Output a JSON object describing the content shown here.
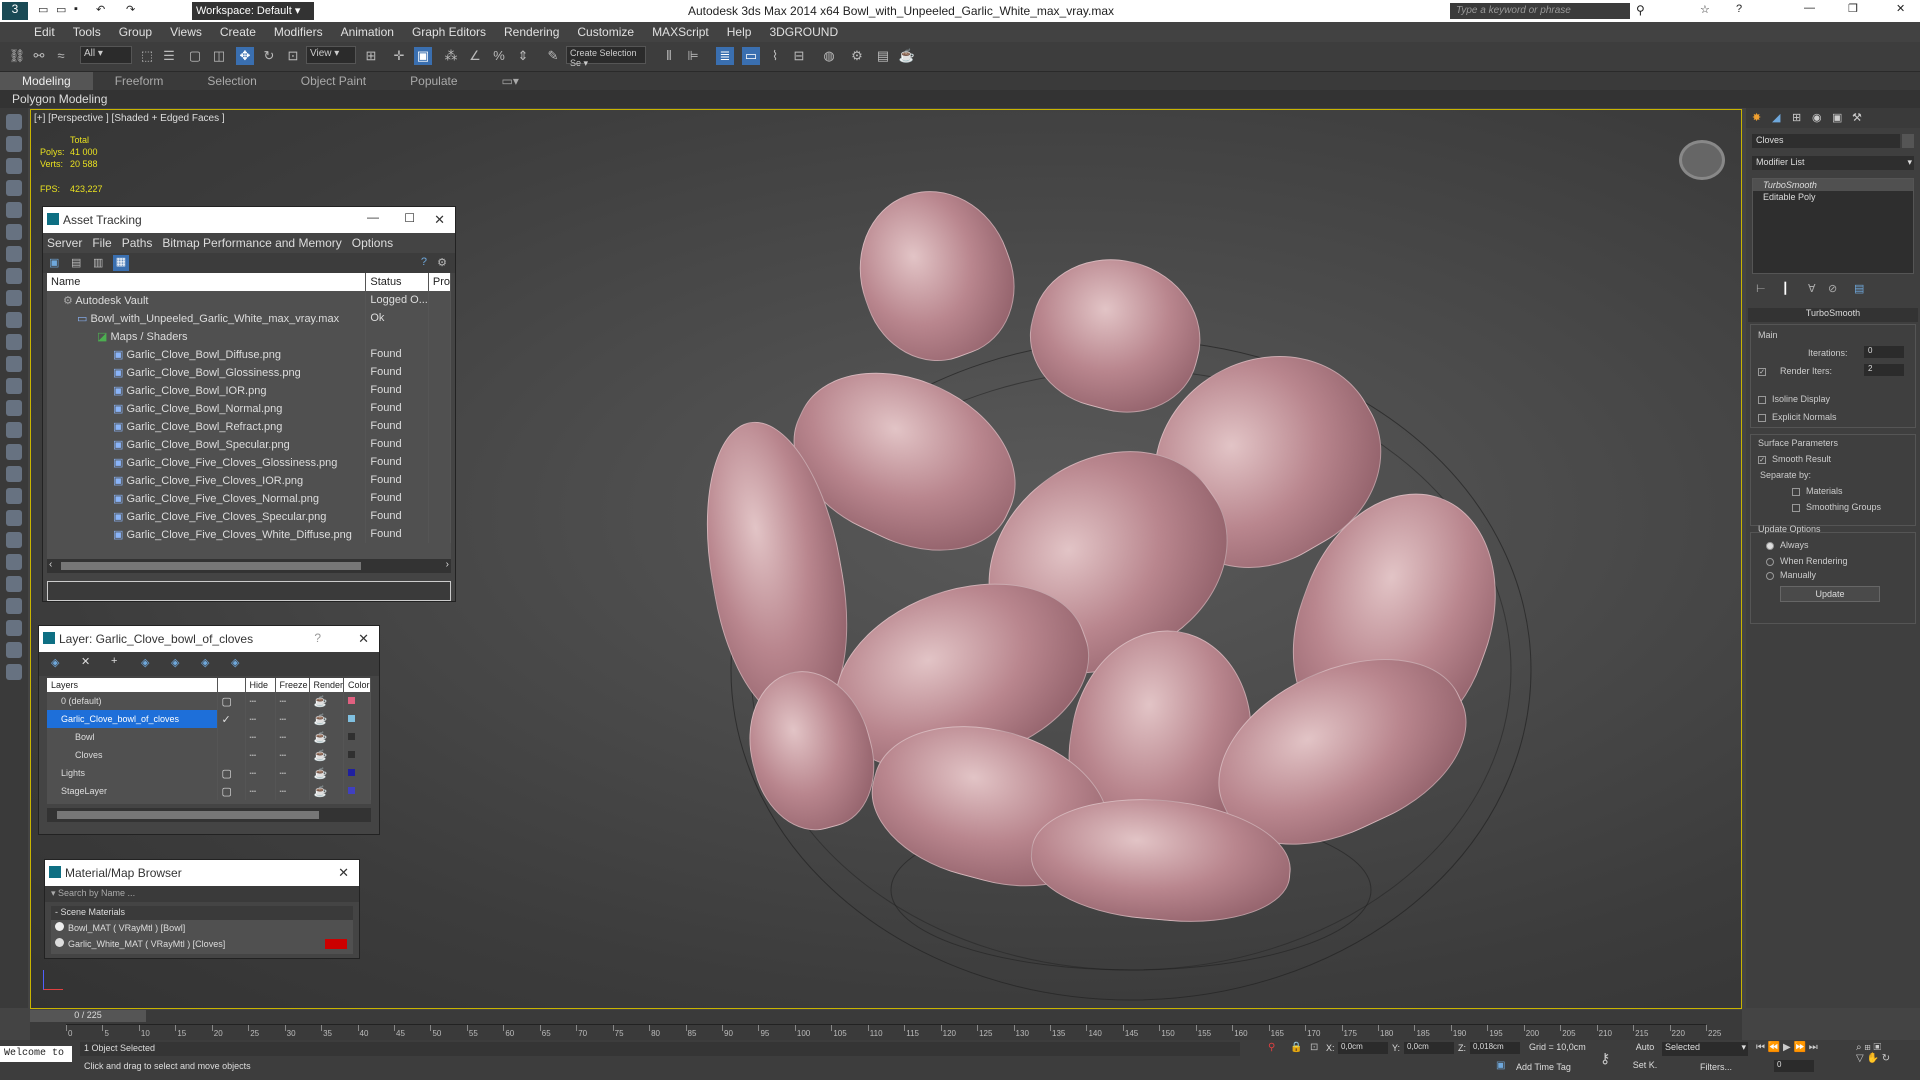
{
  "window": {
    "title": "Autodesk 3ds Max  2014 x64      Bowl_with_Unpeeled_Garlic_White_max_vray.max",
    "workspace": "Workspace: Default",
    "search_placeholder": "Type a keyword or phrase"
  },
  "menu": [
    "Edit",
    "Tools",
    "Group",
    "Views",
    "Create",
    "Modifiers",
    "Animation",
    "Graph Editors",
    "Rendering",
    "Customize",
    "MAXScript",
    "Help",
    "3DGROUND"
  ],
  "toolbar": {
    "filter": "All",
    "ref_coord": "View",
    "named_sel": "Create Selection Se"
  },
  "ribbon": {
    "tabs": [
      "Modeling",
      "Freeform",
      "Selection",
      "Object Paint",
      "Populate"
    ],
    "active": "Modeling",
    "subpanel": "Polygon Modeling"
  },
  "viewport": {
    "label": "[+] [Perspective ] [Shaded + Edged Faces ]",
    "stats_total": "Total",
    "polys_label": "Polys:",
    "polys": "41 000",
    "verts_label": "Verts:",
    "verts": "20 588",
    "fps_label": "FPS:",
    "fps": "423,227"
  },
  "asset_tracking": {
    "title": "Asset Tracking",
    "menu": [
      "Server",
      "File",
      "Paths",
      "Bitmap Performance and Memory",
      "Options"
    ],
    "columns": [
      "Name",
      "Status",
      "Pro"
    ],
    "rows": [
      {
        "name": "Autodesk Vault",
        "status": "Logged O..."
      },
      {
        "name": "Bowl_with_Unpeeled_Garlic_White_max_vray.max",
        "status": "Ok"
      },
      {
        "name": "Maps / Shaders",
        "status": ""
      },
      {
        "name": "Garlic_Clove_Bowl_Diffuse.png",
        "status": "Found"
      },
      {
        "name": "Garlic_Clove_Bowl_Glossiness.png",
        "status": "Found"
      },
      {
        "name": "Garlic_Clove_Bowl_IOR.png",
        "status": "Found"
      },
      {
        "name": "Garlic_Clove_Bowl_Normal.png",
        "status": "Found"
      },
      {
        "name": "Garlic_Clove_Bowl_Refract.png",
        "status": "Found"
      },
      {
        "name": "Garlic_Clove_Bowl_Specular.png",
        "status": "Found"
      },
      {
        "name": "Garlic_Clove_Five_Cloves_Glossiness.png",
        "status": "Found"
      },
      {
        "name": "Garlic_Clove_Five_Cloves_IOR.png",
        "status": "Found"
      },
      {
        "name": "Garlic_Clove_Five_Cloves_Normal.png",
        "status": "Found"
      },
      {
        "name": "Garlic_Clove_Five_Cloves_Specular.png",
        "status": "Found"
      },
      {
        "name": "Garlic_Clove_Five_Cloves_White_Diffuse.png",
        "status": "Found"
      }
    ]
  },
  "layer_panel": {
    "title": "Layer: Garlic_Clove_bowl_of_cloves",
    "help": "?",
    "columns": [
      "Layers",
      "Hide",
      "Freeze",
      "Render",
      "Color"
    ],
    "rows": [
      {
        "name": "0 (default)",
        "color": "#e06080"
      },
      {
        "name": "Garlic_Clove_bowl_of_cloves",
        "color": "#80c0e0"
      },
      {
        "name": "Bowl",
        "color": "#303030"
      },
      {
        "name": "Cloves",
        "color": "#303030"
      },
      {
        "name": "Lights",
        "color": "#2020a0"
      },
      {
        "name": "StageLayer",
        "color": "#4040c0"
      }
    ]
  },
  "material_browser": {
    "title": "Material/Map Browser",
    "search_placeholder": "Search by Name ...",
    "group": "- Scene Materials",
    "items": [
      "Bowl_MAT ( VRayMtl ) [Bowl]",
      "Garlic_White_MAT ( VRayMtl ) [Cloves]"
    ]
  },
  "command_panel": {
    "object_name": "Cloves",
    "modifier_list": "Modifier List",
    "stack": [
      "TurboSmooth",
      "Editable Poly"
    ],
    "rollout": "TurboSmooth",
    "main": "Main",
    "iterations_label": "Iterations:",
    "iterations": "0",
    "render_iters_label": "Render Iters:",
    "render_iters": "2",
    "isoline": "Isoline Display",
    "explicit": "Explicit Normals",
    "surface": "Surface Parameters",
    "smooth": "Smooth Result",
    "separate": "Separate by:",
    "materials": "Materials",
    "smoothing": "Smoothing Groups",
    "update_options": "Update Options",
    "always": "Always",
    "when_rendering": "When Rendering",
    "manually": "Manually",
    "update": "Update"
  },
  "timeline": {
    "frame": "0 / 225",
    "ticks": [
      "0",
      "5",
      "10",
      "15",
      "20",
      "25",
      "30",
      "35",
      "40",
      "45",
      "50",
      "55",
      "60",
      "65",
      "70",
      "75",
      "80",
      "85",
      "90",
      "95",
      "100",
      "105",
      "110",
      "115",
      "120",
      "125",
      "130",
      "135",
      "140",
      "145",
      "150",
      "155",
      "160",
      "165",
      "170",
      "175",
      "180",
      "185",
      "190",
      "195",
      "200",
      "205",
      "210",
      "215",
      "220",
      "225"
    ]
  },
  "status": {
    "maxscript": "Welcome to",
    "selected": "1 Object Selected",
    "prompt": "Click and drag to select and move objects",
    "x_label": "X:",
    "x": "0,0cm",
    "y_label": "Y:",
    "y": "0,0cm",
    "z_label": "Z:",
    "z": "0,018cm",
    "grid": "Grid = 10,0cm",
    "add_time_tag": "Add Time Tag",
    "auto": "Auto",
    "set_k": "Set K.",
    "key_filter": "Selected",
    "filters": "Filters...",
    "frame_field": "0"
  }
}
